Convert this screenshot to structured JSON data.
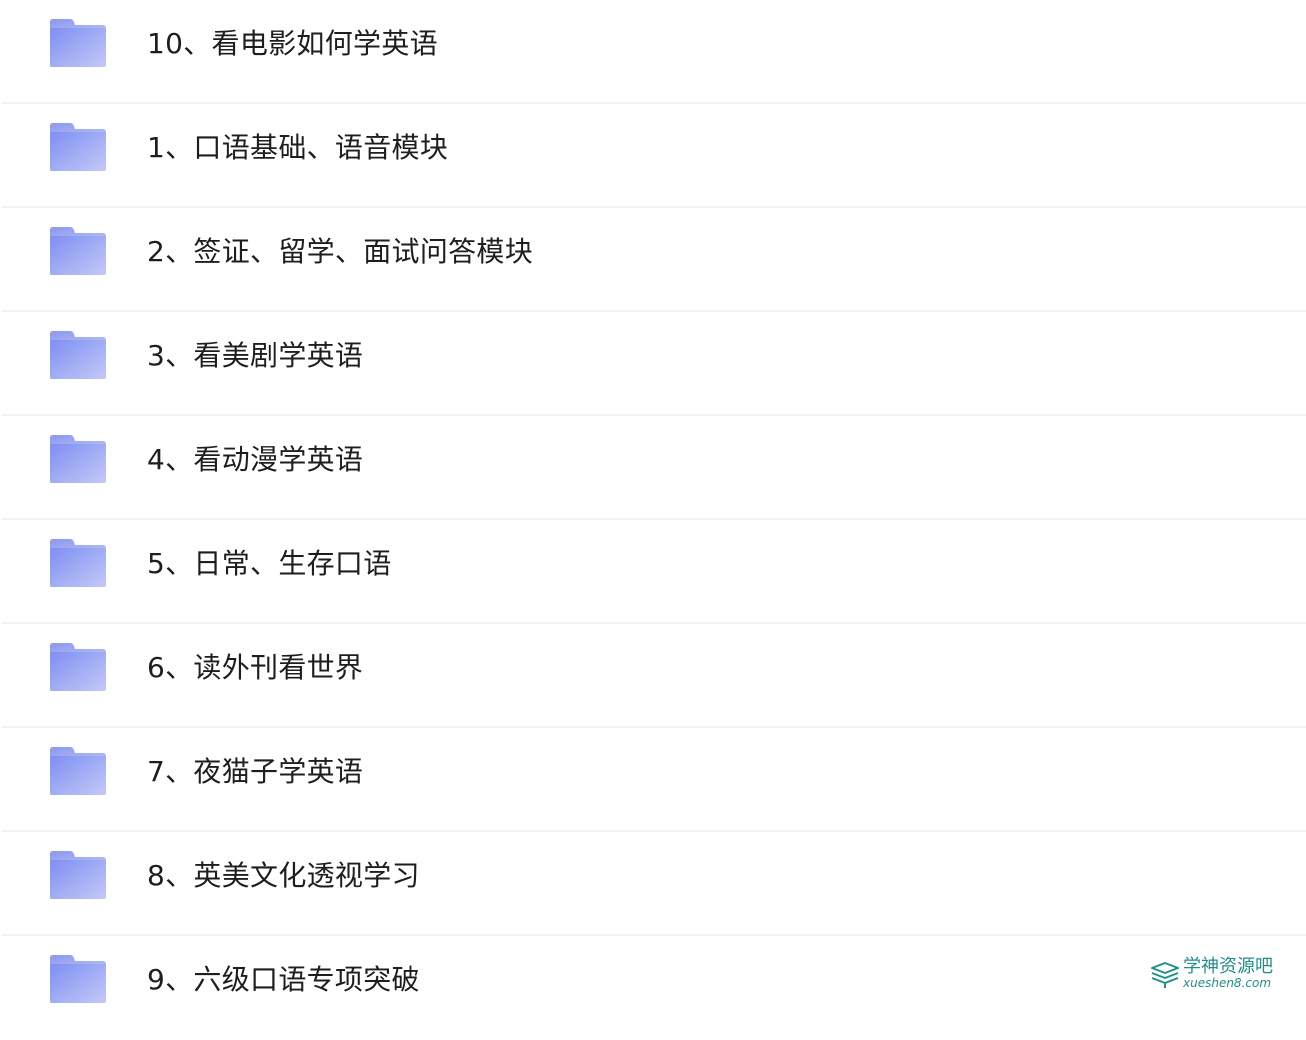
{
  "folders": [
    {
      "name": "10、看电影如何学英语"
    },
    {
      "name": "1、口语基础、语音模块"
    },
    {
      "name": "2、签证、留学、面试问答模块"
    },
    {
      "name": "3、看美剧学英语"
    },
    {
      "name": "4、看动漫学英语"
    },
    {
      "name": "5、日常、生存口语"
    },
    {
      "name": "6、读外刊看世界"
    },
    {
      "name": "7、夜猫子学英语"
    },
    {
      "name": "8、英美文化透视学习"
    },
    {
      "name": "9、六级口语专项突破"
    }
  ],
  "icons": {
    "folder": "folder-icon",
    "watermark": "books-icon"
  },
  "colors": {
    "folder_top": "#8a9cf5",
    "folder_bottom": "#b7c0f7",
    "text": "#1e1e1e",
    "watermark": "#1f8f88"
  },
  "watermark": {
    "title": "学神资源吧",
    "subtitle": "xueshen8.com"
  }
}
